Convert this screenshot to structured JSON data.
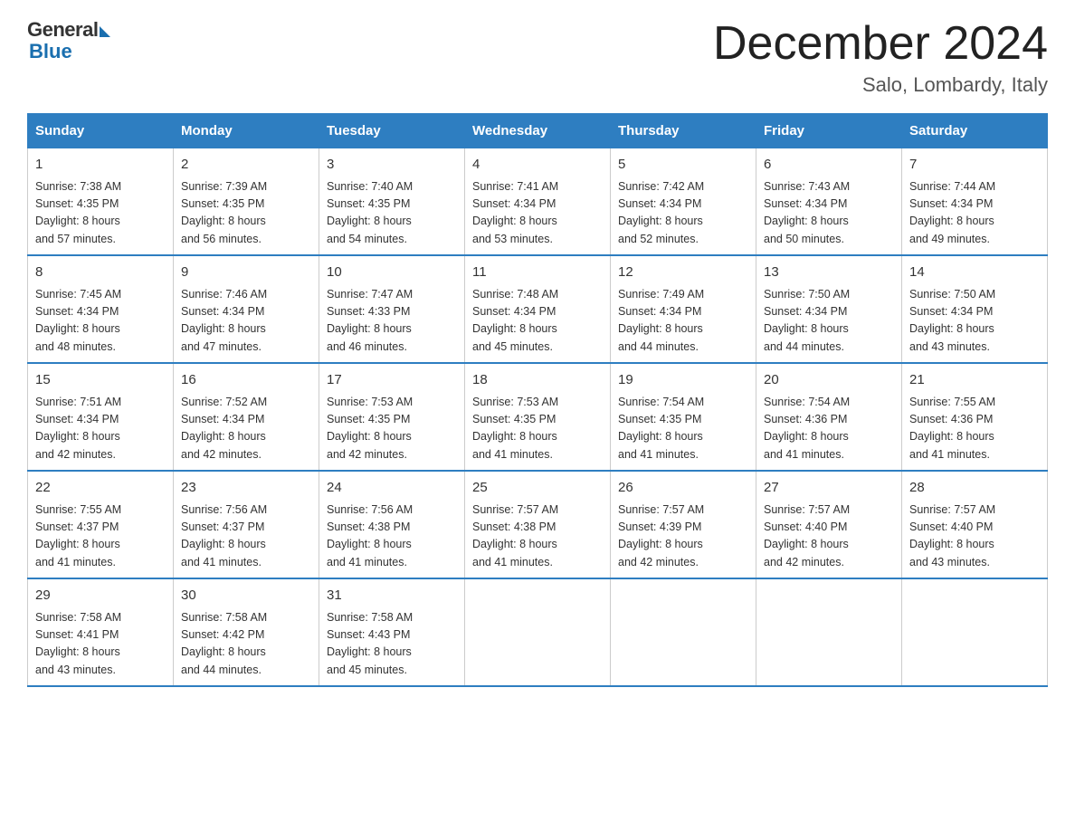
{
  "header": {
    "logo_general": "General",
    "logo_blue": "Blue",
    "month_title": "December 2024",
    "location": "Salo, Lombardy, Italy"
  },
  "weekdays": [
    "Sunday",
    "Monday",
    "Tuesday",
    "Wednesday",
    "Thursday",
    "Friday",
    "Saturday"
  ],
  "weeks": [
    [
      {
        "day": "1",
        "sunrise": "7:38 AM",
        "sunset": "4:35 PM",
        "daylight": "8 hours and 57 minutes."
      },
      {
        "day": "2",
        "sunrise": "7:39 AM",
        "sunset": "4:35 PM",
        "daylight": "8 hours and 56 minutes."
      },
      {
        "day": "3",
        "sunrise": "7:40 AM",
        "sunset": "4:35 PM",
        "daylight": "8 hours and 54 minutes."
      },
      {
        "day": "4",
        "sunrise": "7:41 AM",
        "sunset": "4:34 PM",
        "daylight": "8 hours and 53 minutes."
      },
      {
        "day": "5",
        "sunrise": "7:42 AM",
        "sunset": "4:34 PM",
        "daylight": "8 hours and 52 minutes."
      },
      {
        "day": "6",
        "sunrise": "7:43 AM",
        "sunset": "4:34 PM",
        "daylight": "8 hours and 50 minutes."
      },
      {
        "day": "7",
        "sunrise": "7:44 AM",
        "sunset": "4:34 PM",
        "daylight": "8 hours and 49 minutes."
      }
    ],
    [
      {
        "day": "8",
        "sunrise": "7:45 AM",
        "sunset": "4:34 PM",
        "daylight": "8 hours and 48 minutes."
      },
      {
        "day": "9",
        "sunrise": "7:46 AM",
        "sunset": "4:34 PM",
        "daylight": "8 hours and 47 minutes."
      },
      {
        "day": "10",
        "sunrise": "7:47 AM",
        "sunset": "4:33 PM",
        "daylight": "8 hours and 46 minutes."
      },
      {
        "day": "11",
        "sunrise": "7:48 AM",
        "sunset": "4:34 PM",
        "daylight": "8 hours and 45 minutes."
      },
      {
        "day": "12",
        "sunrise": "7:49 AM",
        "sunset": "4:34 PM",
        "daylight": "8 hours and 44 minutes."
      },
      {
        "day": "13",
        "sunrise": "7:50 AM",
        "sunset": "4:34 PM",
        "daylight": "8 hours and 44 minutes."
      },
      {
        "day": "14",
        "sunrise": "7:50 AM",
        "sunset": "4:34 PM",
        "daylight": "8 hours and 43 minutes."
      }
    ],
    [
      {
        "day": "15",
        "sunrise": "7:51 AM",
        "sunset": "4:34 PM",
        "daylight": "8 hours and 42 minutes."
      },
      {
        "day": "16",
        "sunrise": "7:52 AM",
        "sunset": "4:34 PM",
        "daylight": "8 hours and 42 minutes."
      },
      {
        "day": "17",
        "sunrise": "7:53 AM",
        "sunset": "4:35 PM",
        "daylight": "8 hours and 42 minutes."
      },
      {
        "day": "18",
        "sunrise": "7:53 AM",
        "sunset": "4:35 PM",
        "daylight": "8 hours and 41 minutes."
      },
      {
        "day": "19",
        "sunrise": "7:54 AM",
        "sunset": "4:35 PM",
        "daylight": "8 hours and 41 minutes."
      },
      {
        "day": "20",
        "sunrise": "7:54 AM",
        "sunset": "4:36 PM",
        "daylight": "8 hours and 41 minutes."
      },
      {
        "day": "21",
        "sunrise": "7:55 AM",
        "sunset": "4:36 PM",
        "daylight": "8 hours and 41 minutes."
      }
    ],
    [
      {
        "day": "22",
        "sunrise": "7:55 AM",
        "sunset": "4:37 PM",
        "daylight": "8 hours and 41 minutes."
      },
      {
        "day": "23",
        "sunrise": "7:56 AM",
        "sunset": "4:37 PM",
        "daylight": "8 hours and 41 minutes."
      },
      {
        "day": "24",
        "sunrise": "7:56 AM",
        "sunset": "4:38 PM",
        "daylight": "8 hours and 41 minutes."
      },
      {
        "day": "25",
        "sunrise": "7:57 AM",
        "sunset": "4:38 PM",
        "daylight": "8 hours and 41 minutes."
      },
      {
        "day": "26",
        "sunrise": "7:57 AM",
        "sunset": "4:39 PM",
        "daylight": "8 hours and 42 minutes."
      },
      {
        "day": "27",
        "sunrise": "7:57 AM",
        "sunset": "4:40 PM",
        "daylight": "8 hours and 42 minutes."
      },
      {
        "day": "28",
        "sunrise": "7:57 AM",
        "sunset": "4:40 PM",
        "daylight": "8 hours and 43 minutes."
      }
    ],
    [
      {
        "day": "29",
        "sunrise": "7:58 AM",
        "sunset": "4:41 PM",
        "daylight": "8 hours and 43 minutes."
      },
      {
        "day": "30",
        "sunrise": "7:58 AM",
        "sunset": "4:42 PM",
        "daylight": "8 hours and 44 minutes."
      },
      {
        "day": "31",
        "sunrise": "7:58 AM",
        "sunset": "4:43 PM",
        "daylight": "8 hours and 45 minutes."
      },
      null,
      null,
      null,
      null
    ]
  ],
  "labels": {
    "sunrise": "Sunrise:",
    "sunset": "Sunset:",
    "daylight": "Daylight:"
  }
}
